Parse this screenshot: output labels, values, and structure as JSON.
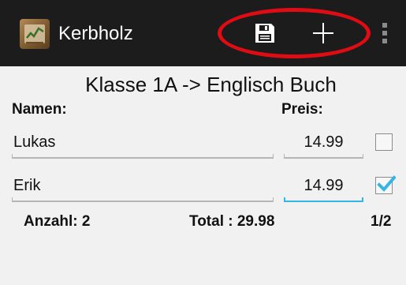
{
  "actionbar": {
    "app_title": "Kerbholz",
    "app_icon": "kerbholz-app-icon",
    "save_icon": "floppy-disk-icon",
    "add_icon": "plus-icon",
    "overflow_icon": "overflow-menu-icon",
    "highlight_color": "#e00c14"
  },
  "main": {
    "heading": "Klasse 1A -> Englisch Buch",
    "name_header": "Namen:",
    "price_header": "Preis:",
    "rows": [
      {
        "name": "Lukas",
        "price": "14.99",
        "checked": false
      },
      {
        "name": "Erik",
        "price": "14.99",
        "checked": true
      }
    ],
    "accent_color": "#33b5e5"
  },
  "footer": {
    "count": "Anzahl: 2",
    "total": "Total : 29.98",
    "pager": "1/2"
  }
}
